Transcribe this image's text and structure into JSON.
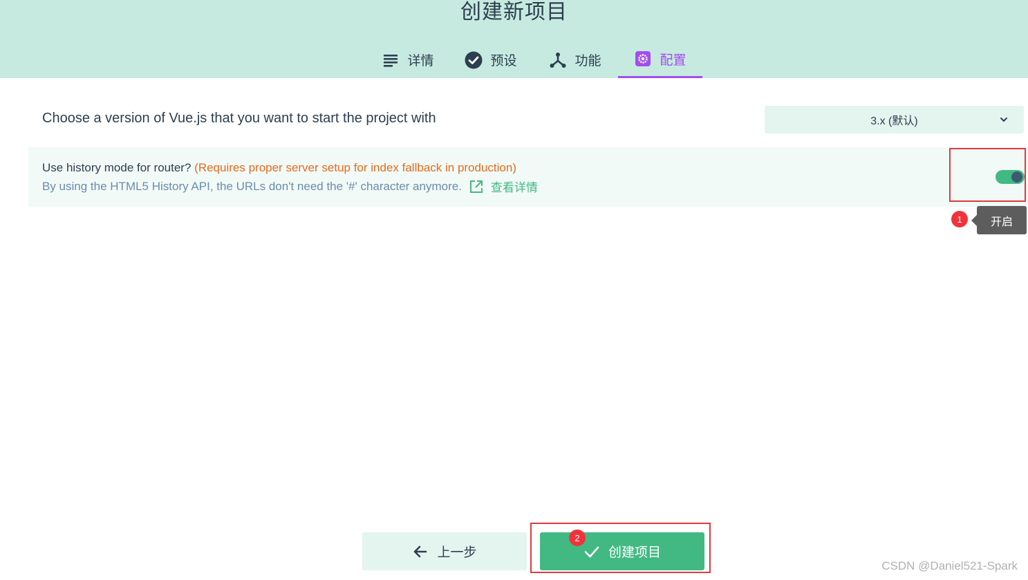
{
  "header": {
    "title": "创建新项目",
    "tabs": [
      {
        "label": "详情",
        "icon": "list-icon"
      },
      {
        "label": "预设",
        "icon": "check-circle-icon"
      },
      {
        "label": "功能",
        "icon": "fork-icon"
      },
      {
        "label": "配置",
        "icon": "gear-icon",
        "active": true
      }
    ]
  },
  "config": {
    "version_label": "Choose a version of Vue.js that you want to start the project with",
    "version_value": "3.x (默认)",
    "history_label": "Use history mode for router?",
    "history_warning": "(Requires proper server setup for index fallback in production)",
    "history_desc": "By using the HTML5 History API, the URLs don't need the '#' character anymore.",
    "more_info": "查看详情",
    "history_enabled": true,
    "tooltip": "开启"
  },
  "annotations": {
    "badge1": "1",
    "badge2": "2"
  },
  "footer": {
    "prev_label": "上一步",
    "create_label": "创建项目"
  },
  "watermark": "CSDN @Daniel521-Spark",
  "colors": {
    "header_bg": "#c6eadf",
    "accent": "#42b983",
    "active_tab": "#a44cf0",
    "warning": "#e56a1c",
    "annotation": "#e0393e"
  }
}
